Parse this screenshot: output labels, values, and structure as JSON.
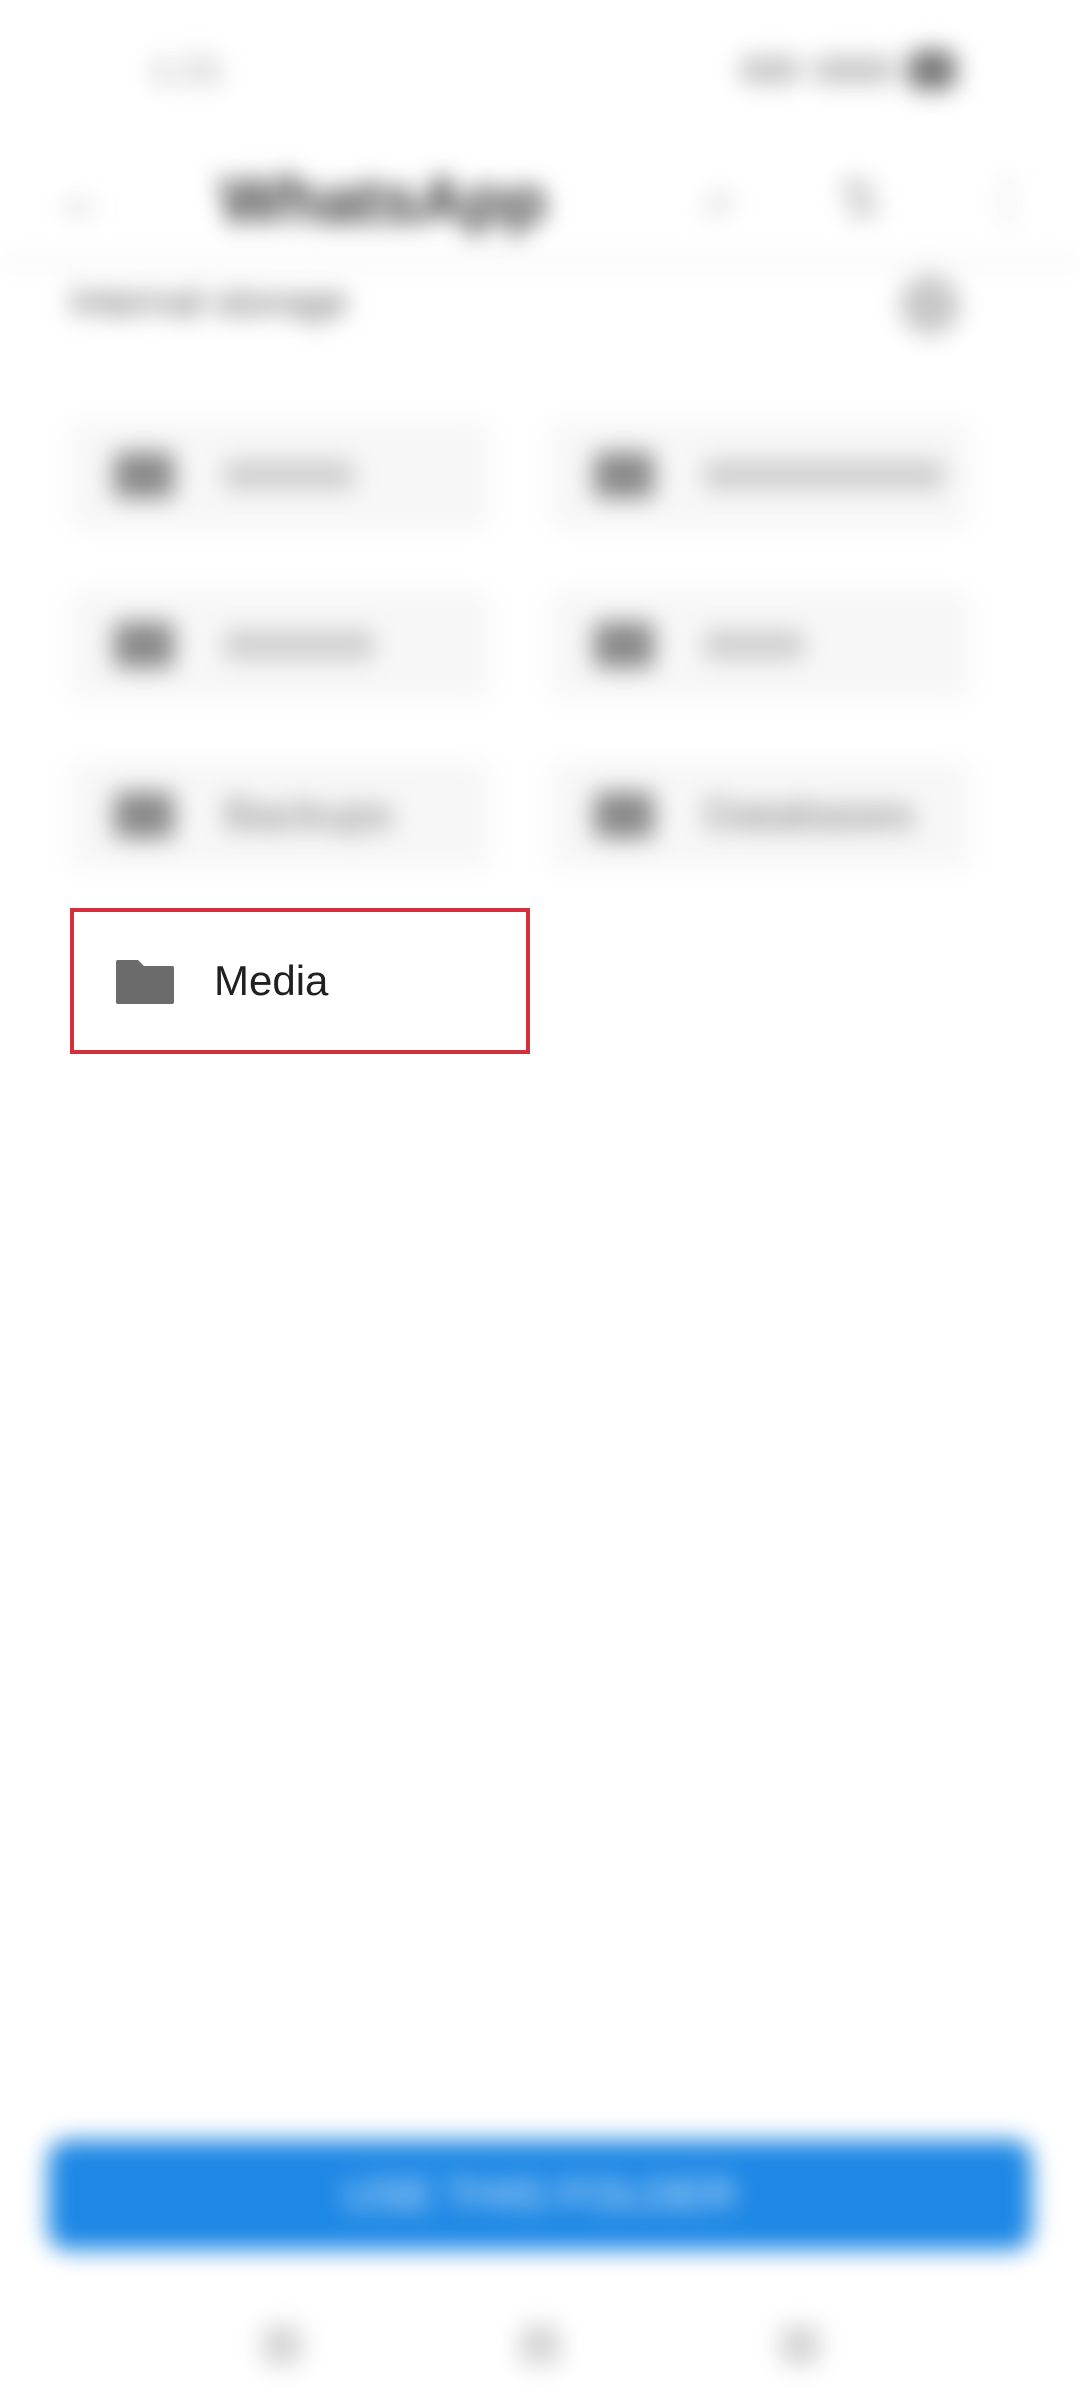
{
  "status_bar": {
    "time": "1:21"
  },
  "app_bar": {
    "title": "WhatsApp",
    "back_icon": "arrow-left-icon",
    "action_icons": [
      "search-icon",
      "sort-icon",
      "more-vert-icon"
    ]
  },
  "path": {
    "text": "Internal storage"
  },
  "folder_grid": {
    "items": [
      {
        "label": "Backups"
      },
      {
        "label": "Databases"
      },
      {
        "label": "Media"
      }
    ]
  },
  "media_item": {
    "label": "Media",
    "icon": "folder-icon",
    "highlight_color": "#d32f3c"
  },
  "bottom_button": {
    "label": "USE THIS FOLDER",
    "color": "#1e88e5"
  },
  "nav_bar": {
    "keys": [
      "back-icon",
      "home-icon",
      "recents-icon"
    ]
  }
}
